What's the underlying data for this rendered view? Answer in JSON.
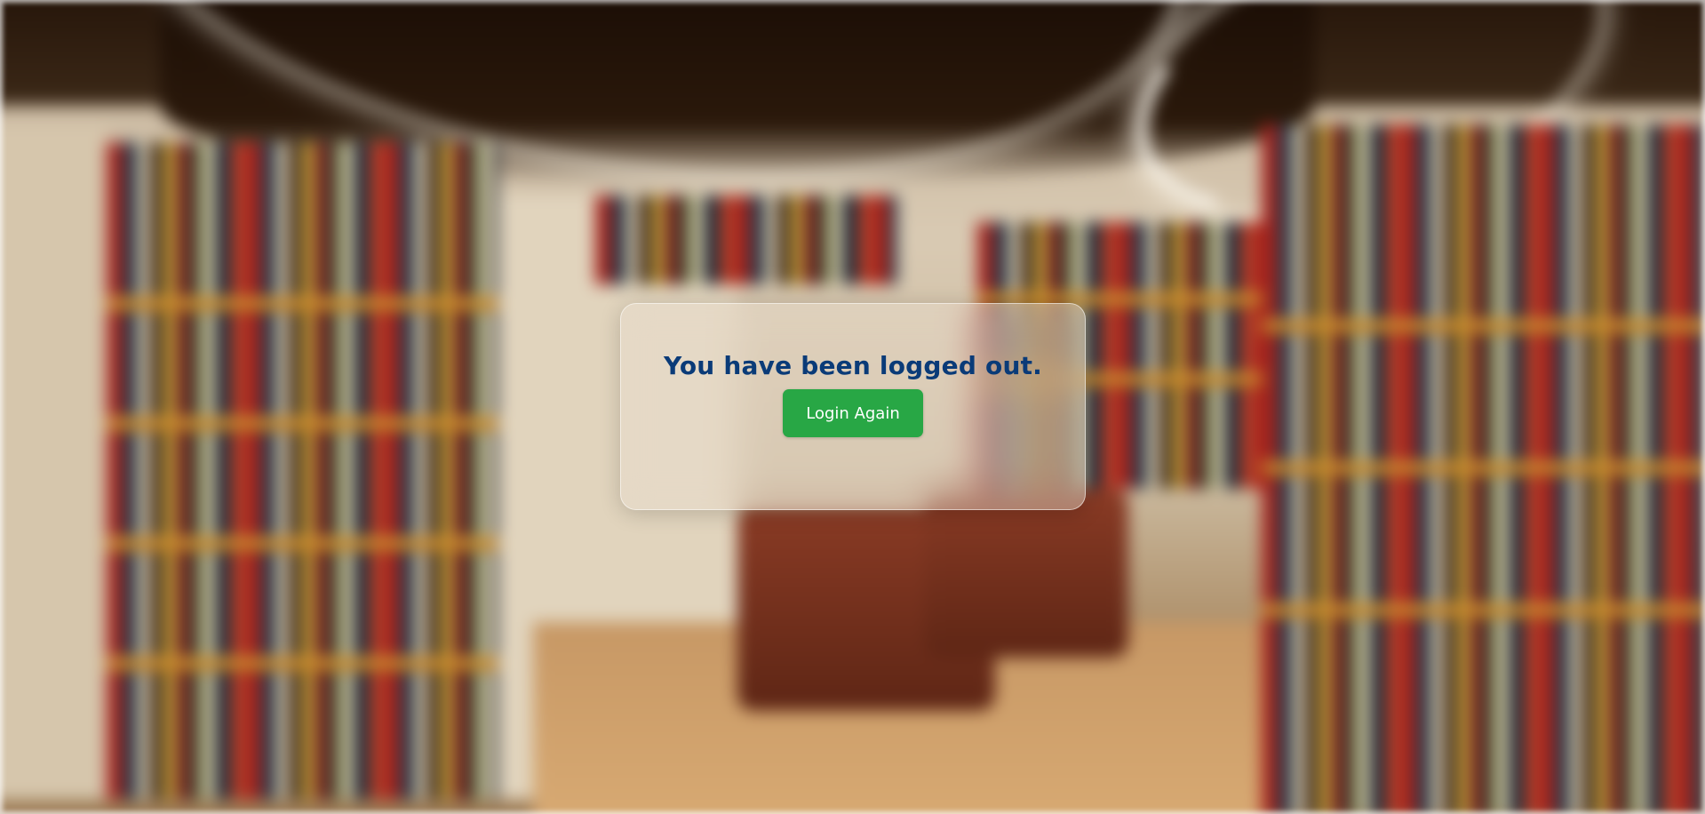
{
  "logout_card": {
    "message": "You have been logged out.",
    "login_again_label": "Login Again"
  },
  "colors": {
    "message_text": "#0a3b78",
    "button_background": "#28a745",
    "button_text": "#ffffff"
  },
  "background": {
    "description_icon": "blurred-library-background"
  }
}
